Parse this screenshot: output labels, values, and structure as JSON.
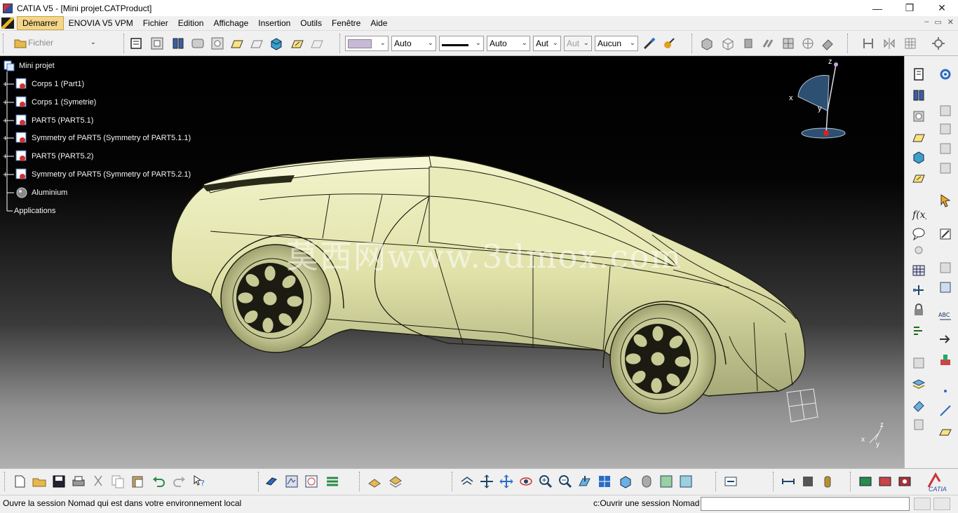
{
  "window": {
    "title": "CATIA V5 - [Mini projet.CATProduct]",
    "controls": [
      "—",
      "❐",
      "✕"
    ]
  },
  "menubar": {
    "items": [
      "Démarrer",
      "ENOVIA V5 VPM",
      "Fichier",
      "Edition",
      "Affichage",
      "Insertion",
      "Outils",
      "Fenêtre",
      "Aide"
    ],
    "mdi_controls": [
      "–",
      "▭",
      "✕"
    ]
  },
  "toolbar_top": {
    "file_combo": "Fichier",
    "color_combo": "",
    "transparency_combo": "Auto",
    "linetype_combo": "",
    "thickness_combo": "Auto",
    "combo_aut1": "Aut",
    "combo_aut2": "Aut",
    "layer_combo": "Aucun"
  },
  "tree": {
    "root": "Mini projet",
    "nodes": [
      "Corps 1 (Part1)",
      "Corps 1 (Symetrie)",
      "PART5 (PART5.1)",
      "Symmetry of PART5 (Symmetry of PART5.1.1)",
      "PART5 (PART5.2)",
      "Symmetry of PART5 (Symmetry of PART5.2.1)"
    ],
    "material": "Aluminium",
    "applications": "Applications"
  },
  "viewport": {
    "watermark": "莫西网www.3dmox.com",
    "compass_labels": {
      "z": "z",
      "x": "x",
      "y": "y"
    },
    "axis_labels": {
      "z": "z",
      "x": "x",
      "y": "y"
    }
  },
  "statusbar": {
    "message": "Ouvre la session Nomad qui est dans votre environnement local",
    "command_label": "c:Ouvrir une session Nomad",
    "command_value": ""
  },
  "colors": {
    "car_body": "#e3e5b2",
    "menu_active": "#f4d68a",
    "chrome": "#f0f0f0"
  }
}
